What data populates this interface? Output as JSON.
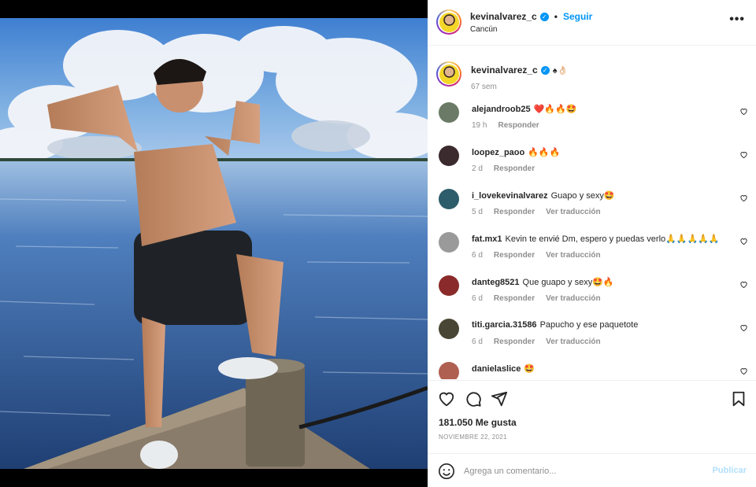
{
  "post": {
    "username": "kevinalvarez_c",
    "follow_label": "Seguir",
    "location": "Cancún",
    "more_label": "•••",
    "caption_emojis": "♠👌🏻",
    "caption_time": "67 sem",
    "likes": "181.050 Me gusta",
    "date": "NOVIEMBRE 22, 2021"
  },
  "comments": [
    {
      "user": "alejandroob25",
      "text": "❤️🔥🔥🤩",
      "time": "19 h",
      "reply": "Responder",
      "translate": "",
      "avatar_color": "#6a7a66"
    },
    {
      "user": "loopez_paoo",
      "text": "🔥🔥🔥",
      "time": "2 d",
      "reply": "Responder",
      "translate": "",
      "avatar_color": "#3b2a2e"
    },
    {
      "user": "i_lovekevinalvarez",
      "text": "Guapo y sexy🤩",
      "time": "5 d",
      "reply": "Responder",
      "translate": "Ver traducción",
      "avatar_color": "#2d5c6a"
    },
    {
      "user": "fat.mx1",
      "text": "Kevin te envié Dm, espero y puedas verlo🙏🙏🙏🙏🙏",
      "time": "6 d",
      "reply": "Responder",
      "translate": "Ver traducción",
      "avatar_color": "#9a9a9a"
    },
    {
      "user": "danteg8521",
      "text": "Que guapo y sexy🤩🔥",
      "time": "6 d",
      "reply": "Responder",
      "translate": "Ver traducción",
      "avatar_color": "#8a2a2a"
    },
    {
      "user": "titi.garcia.31586",
      "text": "Papucho y ese paquetote",
      "time": "6 d",
      "reply": "Responder",
      "translate": "Ver traducción",
      "avatar_color": "#4a4636"
    },
    {
      "user": "danielaslice",
      "text": "🤩",
      "time": "",
      "reply": "",
      "translate": "",
      "avatar_color": "#b06050"
    }
  ],
  "comment_input": {
    "placeholder": "Agrega un comentario...",
    "submit_label": "Publicar"
  },
  "icons": [
    "heart-icon",
    "comment-icon",
    "share-icon",
    "bookmark-icon",
    "emoji-icon",
    "verified-icon"
  ],
  "colors": {
    "accent": "#0095f6",
    "muted": "#8e8e8e",
    "text": "#262626"
  }
}
